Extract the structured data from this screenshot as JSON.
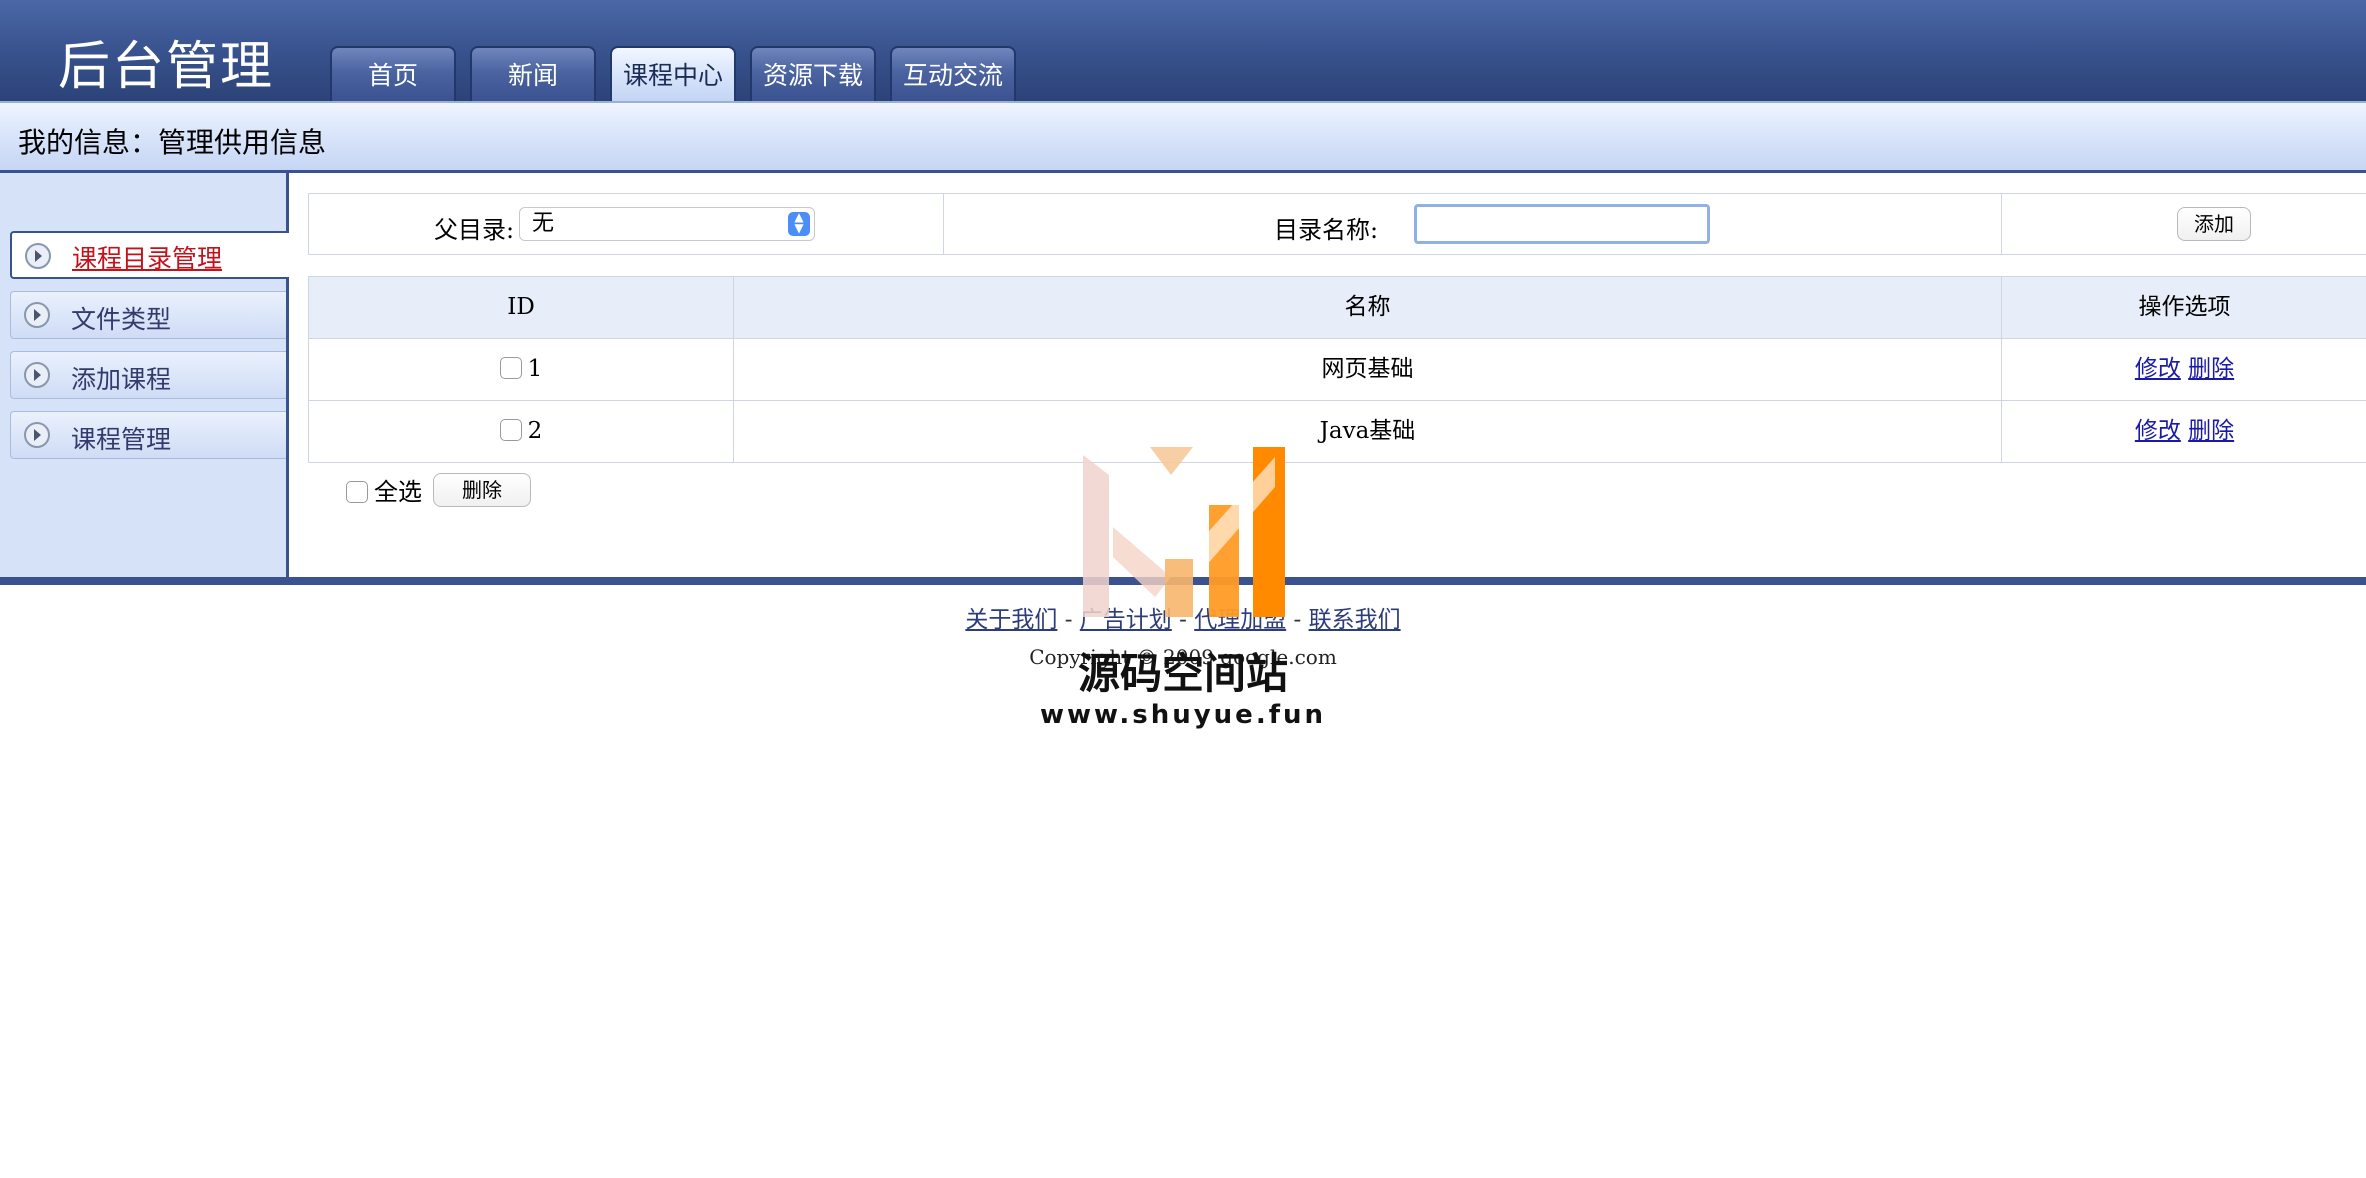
{
  "header": {
    "logo": "后台管理",
    "tabs": [
      {
        "label": "首页",
        "active": false
      },
      {
        "label": "新闻",
        "active": false
      },
      {
        "label": "课程中心",
        "active": true
      },
      {
        "label": "资源下载",
        "active": false
      },
      {
        "label": "互动交流",
        "active": false
      }
    ]
  },
  "infobar": {
    "label": "我的信息：管理供用信息"
  },
  "sidebar": {
    "items": [
      {
        "label": "课程目录管理",
        "active": true
      },
      {
        "label": "文件类型",
        "active": false
      },
      {
        "label": "添加课程",
        "active": false
      },
      {
        "label": "课程管理",
        "active": false
      }
    ]
  },
  "form": {
    "parent_label": "父目录:",
    "parent_value": "无",
    "name_label": "目录名称:",
    "name_value": "",
    "add_button": "添加"
  },
  "table": {
    "headers": [
      "ID",
      "名称",
      "操作选项"
    ],
    "rows": [
      {
        "id": "1",
        "name": "网页基础",
        "edit": "修改",
        "delete": "删除"
      },
      {
        "id": "2",
        "name": "Java基础",
        "edit": "修改",
        "delete": "删除"
      }
    ]
  },
  "bulk": {
    "select_all": "全选",
    "delete_button": "删除"
  },
  "footer": {
    "links": [
      "关于我们",
      "广告计划",
      "代理加盟",
      "联系我们"
    ],
    "separator": " - ",
    "copyright": "Copyright © 2009 google.com"
  },
  "watermark": {
    "title": "源码空间站",
    "url": "www.shuyue.fun"
  },
  "colors": {
    "header_bg": "#37518c",
    "accent": "#3a5290",
    "sidebar_bg": "#d5e2f8",
    "active_sidebar_text": "#c4121a",
    "link": "#1a1aa6",
    "watermark_orange": "#ff8a00"
  }
}
